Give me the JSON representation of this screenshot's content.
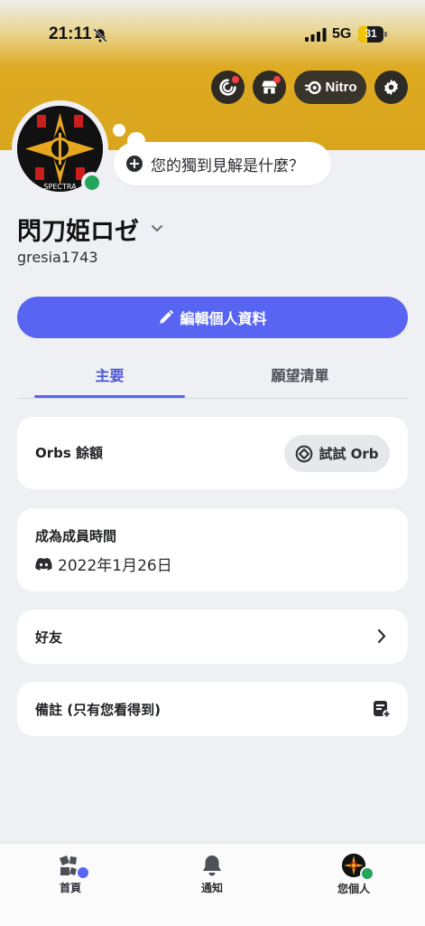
{
  "status_bar": {
    "time": "21:11",
    "network": "5G",
    "battery": "31"
  },
  "profile": {
    "display_name": "閃刀姫ロゼ",
    "username": "gresia1743",
    "status_prompt": "您的獨到見解是什麼？",
    "avatar_text": "SPECTRA"
  },
  "top_buttons": {
    "nitro_label": "Nitro"
  },
  "edit_button": {
    "label": "編輯個人資料"
  },
  "tabs": [
    {
      "label": "主要",
      "active": true
    },
    {
      "label": "願望清單",
      "active": false
    }
  ],
  "orbs": {
    "label": "Orbs 餘額",
    "try_label": "試試 Orb"
  },
  "membership": {
    "label": "成為成員時間",
    "date": "2022年1月26日"
  },
  "friends": {
    "label": "好友"
  },
  "notes": {
    "label": "備註 (只有您看得到)"
  },
  "bottom_nav": [
    {
      "label": "首頁"
    },
    {
      "label": "通知"
    },
    {
      "label": "您個人"
    }
  ],
  "colors": {
    "banner": "#d9a51c",
    "accent": "#5865f2",
    "online": "#23a55a",
    "alert": "#f23f43"
  }
}
